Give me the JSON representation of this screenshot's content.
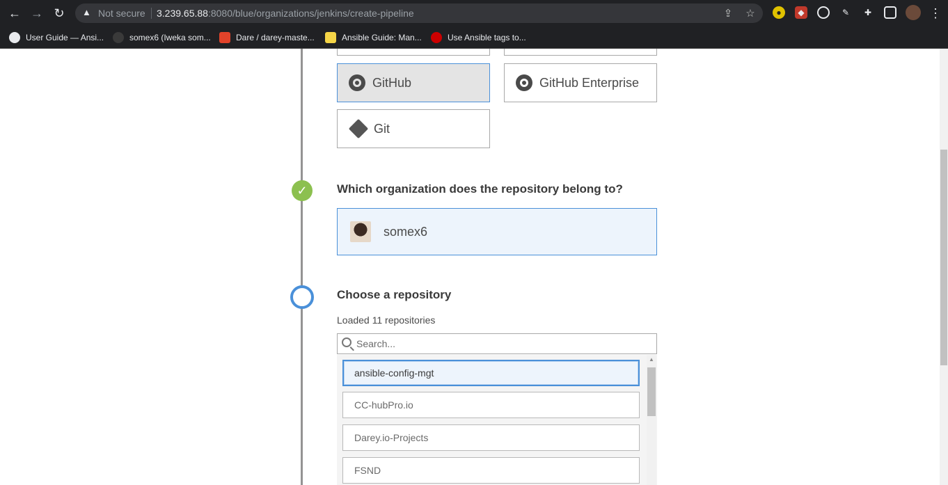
{
  "browser": {
    "security_label": "Not secure",
    "url_host": "3.239.65.88",
    "url_rest": ":8080/blue/organizations/jenkins/create-pipeline",
    "bookmarks": [
      {
        "label": "User Guide — Ansi..."
      },
      {
        "label": "somex6 (Iweka som..."
      },
      {
        "label": "Dare / darey-maste..."
      },
      {
        "label": "Ansible Guide: Man..."
      },
      {
        "label": "Use Ansible tags to..."
      }
    ]
  },
  "scm": {
    "options": [
      {
        "label": "GitHub",
        "selected": true
      },
      {
        "label": "GitHub Enterprise",
        "selected": false
      },
      {
        "label": "Git",
        "selected": false
      }
    ]
  },
  "org_step": {
    "heading": "Which organization does the repository belong to?",
    "org_name": "somex6"
  },
  "repo_step": {
    "heading": "Choose a repository",
    "loaded_text": "Loaded 11 repositories",
    "search_placeholder": "Search...",
    "repositories": [
      {
        "name": "ansible-config-mgt",
        "selected": true
      },
      {
        "name": "CC-hubPro.io",
        "selected": false
      },
      {
        "name": "Darey.io-Projects",
        "selected": false
      },
      {
        "name": "FSND",
        "selected": false
      }
    ]
  },
  "colors": {
    "accent": "#4a90d9",
    "success": "#8cc04f",
    "chrome_bg": "#202124"
  }
}
